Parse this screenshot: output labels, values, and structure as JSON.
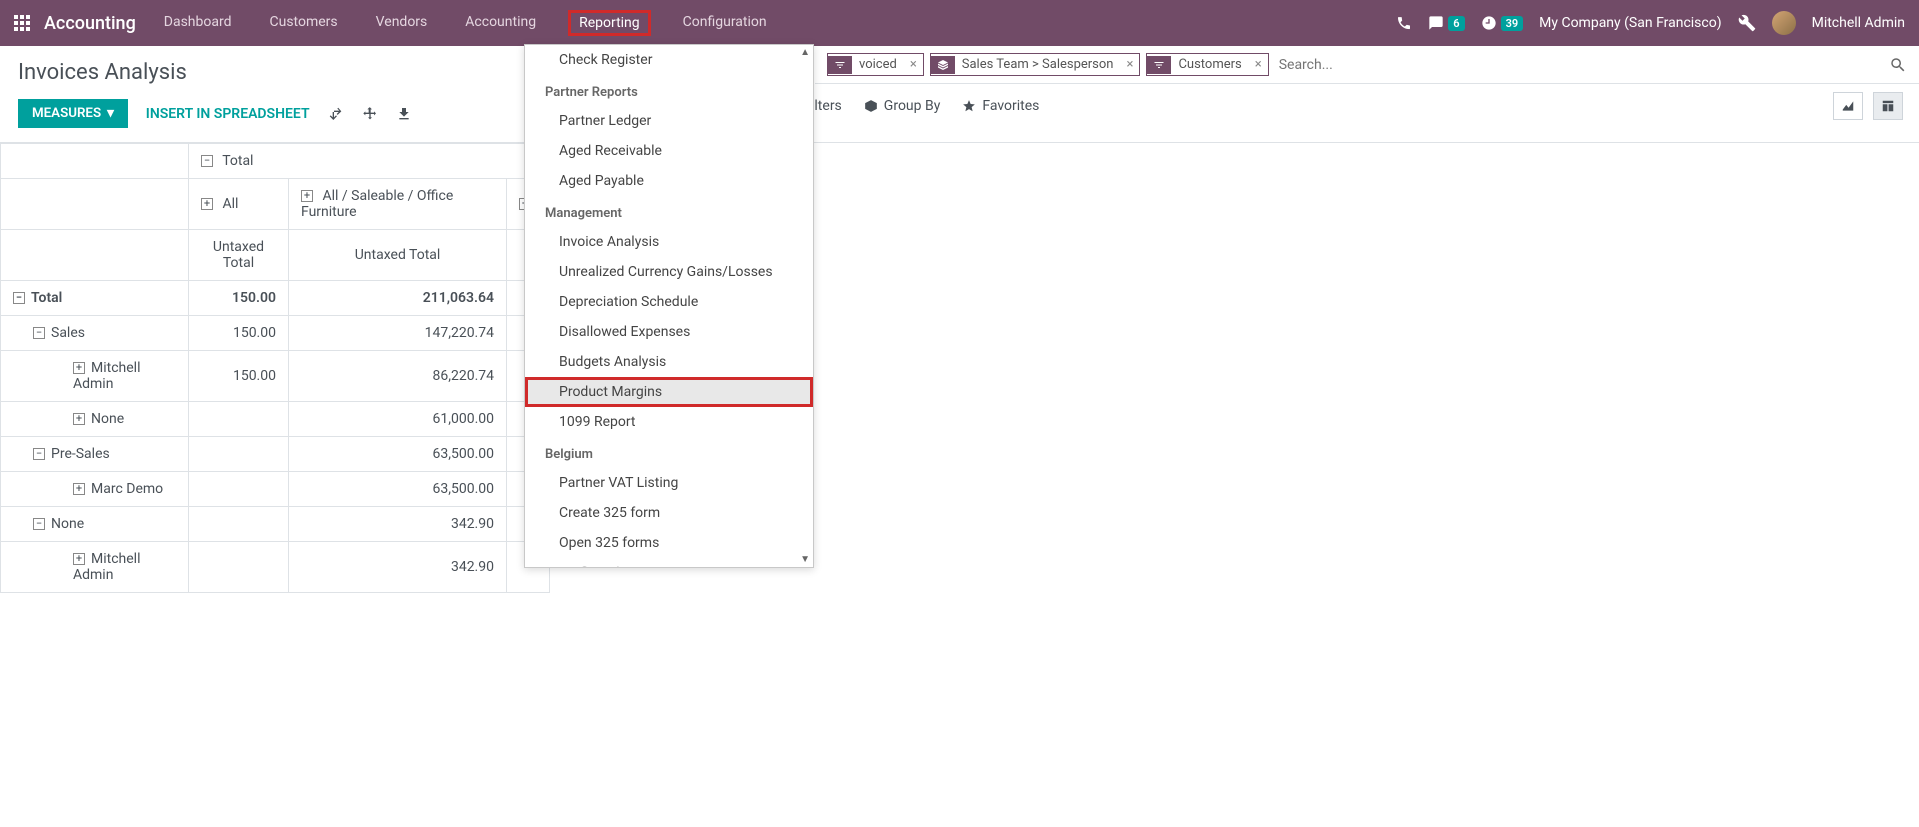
{
  "navbar": {
    "brand": "Accounting",
    "menu": [
      "Dashboard",
      "Customers",
      "Vendors",
      "Accounting",
      "Reporting",
      "Configuration"
    ],
    "highlighted_index": 4,
    "msg_badge": "6",
    "clock_badge": "39",
    "company": "My Company (San Francisco)",
    "user": "Mitchell Admin"
  },
  "page": {
    "title": "Invoices Analysis",
    "measures_btn": "MEASURES",
    "insert_btn": "INSERT IN SPREADSHEET"
  },
  "search": {
    "chips": [
      {
        "icon": "filter",
        "text": "voiced"
      },
      {
        "icon": "layers",
        "text": "Sales Team > Salesperson"
      },
      {
        "icon": "filter",
        "text": "Customers"
      }
    ],
    "placeholder": "Search..."
  },
  "filters": {
    "filters": "ilters",
    "group_by": "Group By",
    "favorites": "Favorites"
  },
  "dropdown": {
    "items": [
      {
        "type": "item",
        "label": "Check Register"
      },
      {
        "type": "header",
        "label": "Partner Reports"
      },
      {
        "type": "item",
        "label": "Partner Ledger"
      },
      {
        "type": "item",
        "label": "Aged Receivable"
      },
      {
        "type": "item",
        "label": "Aged Payable"
      },
      {
        "type": "header",
        "label": "Management"
      },
      {
        "type": "item",
        "label": "Invoice Analysis"
      },
      {
        "type": "item",
        "label": "Unrealized Currency Gains/Losses"
      },
      {
        "type": "item",
        "label": "Depreciation Schedule"
      },
      {
        "type": "item",
        "label": "Disallowed Expenses"
      },
      {
        "type": "item",
        "label": "Budgets Analysis"
      },
      {
        "type": "item",
        "label": "Product Margins",
        "highlighted": true
      },
      {
        "type": "item",
        "label": "1099 Report"
      },
      {
        "type": "header",
        "label": "Belgium"
      },
      {
        "type": "item",
        "label": "Partner VAT Listing"
      },
      {
        "type": "item",
        "label": "Create 325 form"
      },
      {
        "type": "item",
        "label": "Open 325 forms"
      },
      {
        "type": "item",
        "label": "Profit and Loss test",
        "cut": true
      }
    ]
  },
  "pivot": {
    "col_header_total": "Total",
    "col_headers": [
      "All",
      "All / Saleable / Office Furniture"
    ],
    "sub_header": "Untaxed Total",
    "rows": [
      {
        "label": "Total",
        "indent": 0,
        "expand": "-",
        "bold": true,
        "vals": [
          "150.00",
          "211,063.64"
        ]
      },
      {
        "label": "Sales",
        "indent": 1,
        "expand": "-",
        "vals": [
          "150.00",
          "147,220.74"
        ]
      },
      {
        "label": "Mitchell Admin",
        "indent": 2,
        "expand": "+",
        "vals": [
          "150.00",
          "86,220.74"
        ]
      },
      {
        "label": "None",
        "indent": 2,
        "expand": "+",
        "vals": [
          "",
          "61,000.00"
        ]
      },
      {
        "label": "Pre-Sales",
        "indent": 1,
        "expand": "-",
        "vals": [
          "",
          "63,500.00"
        ]
      },
      {
        "label": "Marc Demo",
        "indent": 2,
        "expand": "+",
        "vals": [
          "",
          "63,500.00"
        ]
      },
      {
        "label": "None",
        "indent": 1,
        "expand": "-",
        "vals": [
          "",
          "342.90"
        ]
      },
      {
        "label": "Mitchell Admin",
        "indent": 2,
        "expand": "+",
        "vals": [
          "",
          "342.90"
        ]
      }
    ]
  }
}
